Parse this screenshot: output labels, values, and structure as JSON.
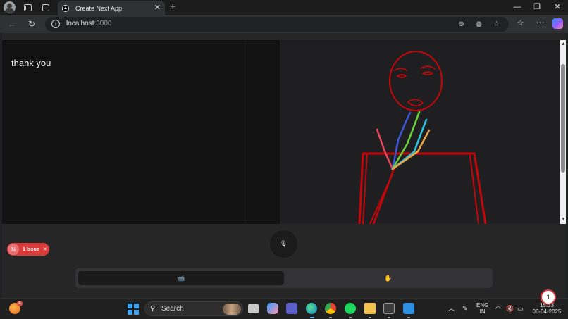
{
  "browser": {
    "tab_title": "Create Next App",
    "tab_close": "✕",
    "new_tab": "+",
    "url_host": "localhost",
    "url_port": ":3000",
    "window_controls": {
      "minimize": "—",
      "restore": "❐",
      "close": "✕"
    }
  },
  "page": {
    "transcript_text": "thank you",
    "mic_icon": "microphone-icon",
    "mode_left_icon": "camera-icon",
    "mode_right_icon": "hand-icon",
    "issues": {
      "initial": "N",
      "label": "1 Issue",
      "close": "✕"
    }
  },
  "colors": {
    "stick_figure": "#c4060a",
    "accent_issue": "#d93a3a",
    "hand_thumb": "#e8445a",
    "hand_index": "#3b56d8",
    "hand_middle": "#6ad13a",
    "hand_ring": "#2bc4d8",
    "hand_pinky": "#e8a64a"
  },
  "taskbar": {
    "search_label": "Search",
    "widget_badge": "4",
    "language": "ENG",
    "region": "IN",
    "time": "15:33",
    "date": "06-04-2025",
    "notification_count": "1",
    "apps": [
      "windows-start-icon",
      "file-explorer-icon",
      "copilot-icon",
      "teams-icon",
      "edge-icon",
      "chrome-icon",
      "spotify-icon",
      "folder-icon",
      "terminal-icon",
      "vscode-icon"
    ]
  }
}
